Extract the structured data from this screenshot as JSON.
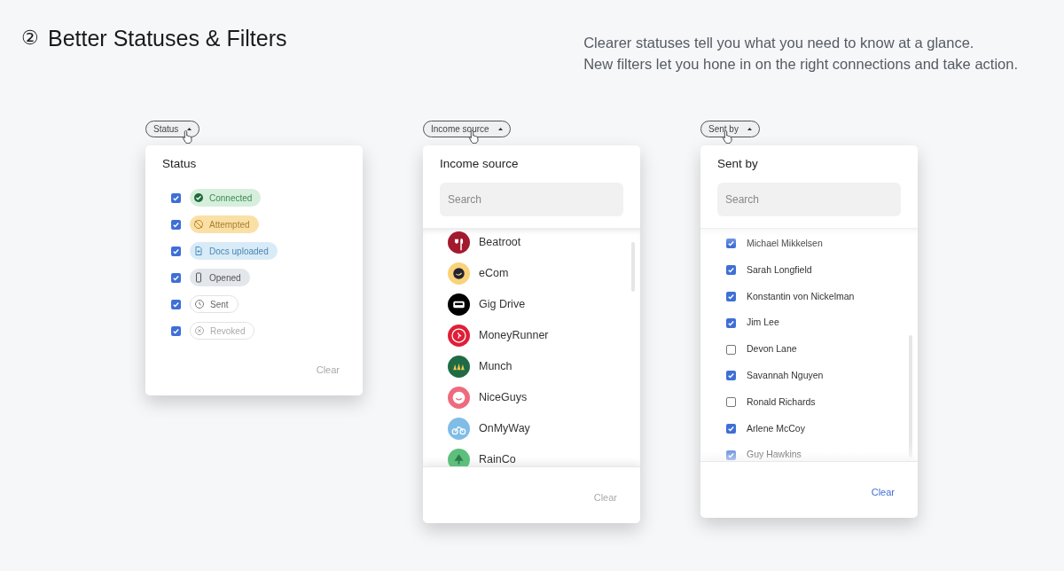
{
  "heading": {
    "number": "②",
    "title": "Better Statuses & Filters"
  },
  "description": [
    "Clearer statuses tell you what you need to know at a glance.",
    "New filters let you hone in on the right connections and take action."
  ],
  "filters": [
    {
      "kind": "status",
      "chip": "Status",
      "title": "Status",
      "clear": {
        "label": "Clear",
        "disabled": true
      },
      "items": [
        {
          "label": "Connected",
          "checked": true,
          "kind": "connected",
          "color": "#d6efdc"
        },
        {
          "label": "Attempted",
          "checked": true,
          "kind": "attempted",
          "color": "#fbe0a6"
        },
        {
          "label": "Docs uploaded",
          "checked": true,
          "kind": "docs",
          "color": "#d9ebf7"
        },
        {
          "label": "Opened",
          "checked": true,
          "kind": "opened",
          "color": "#e3e6ea"
        },
        {
          "label": "Sent",
          "checked": true,
          "kind": "sent",
          "color": "#ffffff"
        },
        {
          "label": "Revoked",
          "checked": true,
          "kind": "revoked",
          "color": "#ffffff"
        }
      ]
    },
    {
      "kind": "source",
      "chip": "Income source",
      "title": "Income source",
      "search": {
        "placeholder": "Search"
      },
      "clear": {
        "label": "Clear",
        "disabled": true
      },
      "items": [
        {
          "label": "Beatroot",
          "color": "#a3192e"
        },
        {
          "label": "eCom",
          "color": "#f9d27a"
        },
        {
          "label": "Gig Drive",
          "color": "#000000"
        },
        {
          "label": "MoneyRunner",
          "color": "#e01e37"
        },
        {
          "label": "Munch",
          "color": "#1f6b45"
        },
        {
          "label": "NiceGuys",
          "color": "#ee6b7e"
        },
        {
          "label": "OnMyWay",
          "color": "#7fbde6"
        },
        {
          "label": "RainCo",
          "color": "#5cbf7c"
        }
      ]
    },
    {
      "kind": "people",
      "chip": "Sent by",
      "title": "Sent by",
      "search": {
        "placeholder": "Search"
      },
      "clear": {
        "label": "Clear",
        "disabled": false
      },
      "items": [
        {
          "label": "Michael Mikkelsen",
          "checked": true
        },
        {
          "label": "Sarah Longfield",
          "checked": true
        },
        {
          "label": "Konstantin von Nickelman",
          "checked": true
        },
        {
          "label": "Jim Lee",
          "checked": true
        },
        {
          "label": "Devon Lane",
          "checked": false
        },
        {
          "label": "Savannah Nguyen",
          "checked": true
        },
        {
          "label": "Ronald Richards",
          "checked": false
        },
        {
          "label": "Arlene McCoy",
          "checked": true
        },
        {
          "label": "Guy Hawkins",
          "checked": true
        }
      ]
    }
  ]
}
